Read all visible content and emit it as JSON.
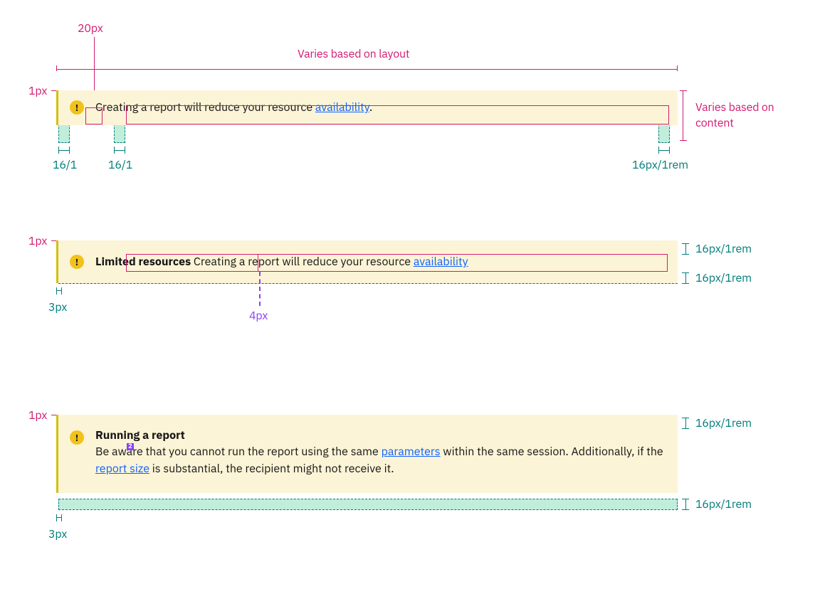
{
  "top": {
    "icon_size_label": "20px",
    "width_label": "Varies based on layout",
    "height_label": "Varies based on content",
    "border_label": "1px",
    "padding_left1": "16/1",
    "padding_left2": "16/1",
    "padding_right": "16px/1rem"
  },
  "notif1": {
    "body_prefix": "Creating a report will reduce your resource ",
    "link": "availability",
    "body_suffix": "."
  },
  "mid": {
    "border_label": "1px",
    "pad_top": "16px/1rem",
    "pad_bottom": "16px/1rem",
    "accent": "3px",
    "title_gap": "4px"
  },
  "notif2": {
    "title": "Limited resources",
    "body_prefix": " Creating a report will reduce your resource ",
    "link": "availability"
  },
  "bot": {
    "border_label": "1px",
    "pad_top": "16px/1rem",
    "pad_bottom": "16px/1rem",
    "accent": "3px",
    "marker": "2"
  },
  "notif3": {
    "title": "Running a report",
    "body_prefix": "Be aware that you cannot run the report using the same ",
    "link1": "parameters",
    "body_mid": " within the same session. Additionally, if the ",
    "link2": "report size",
    "body_suffix": " is substantial, the recipient might not receive it."
  }
}
